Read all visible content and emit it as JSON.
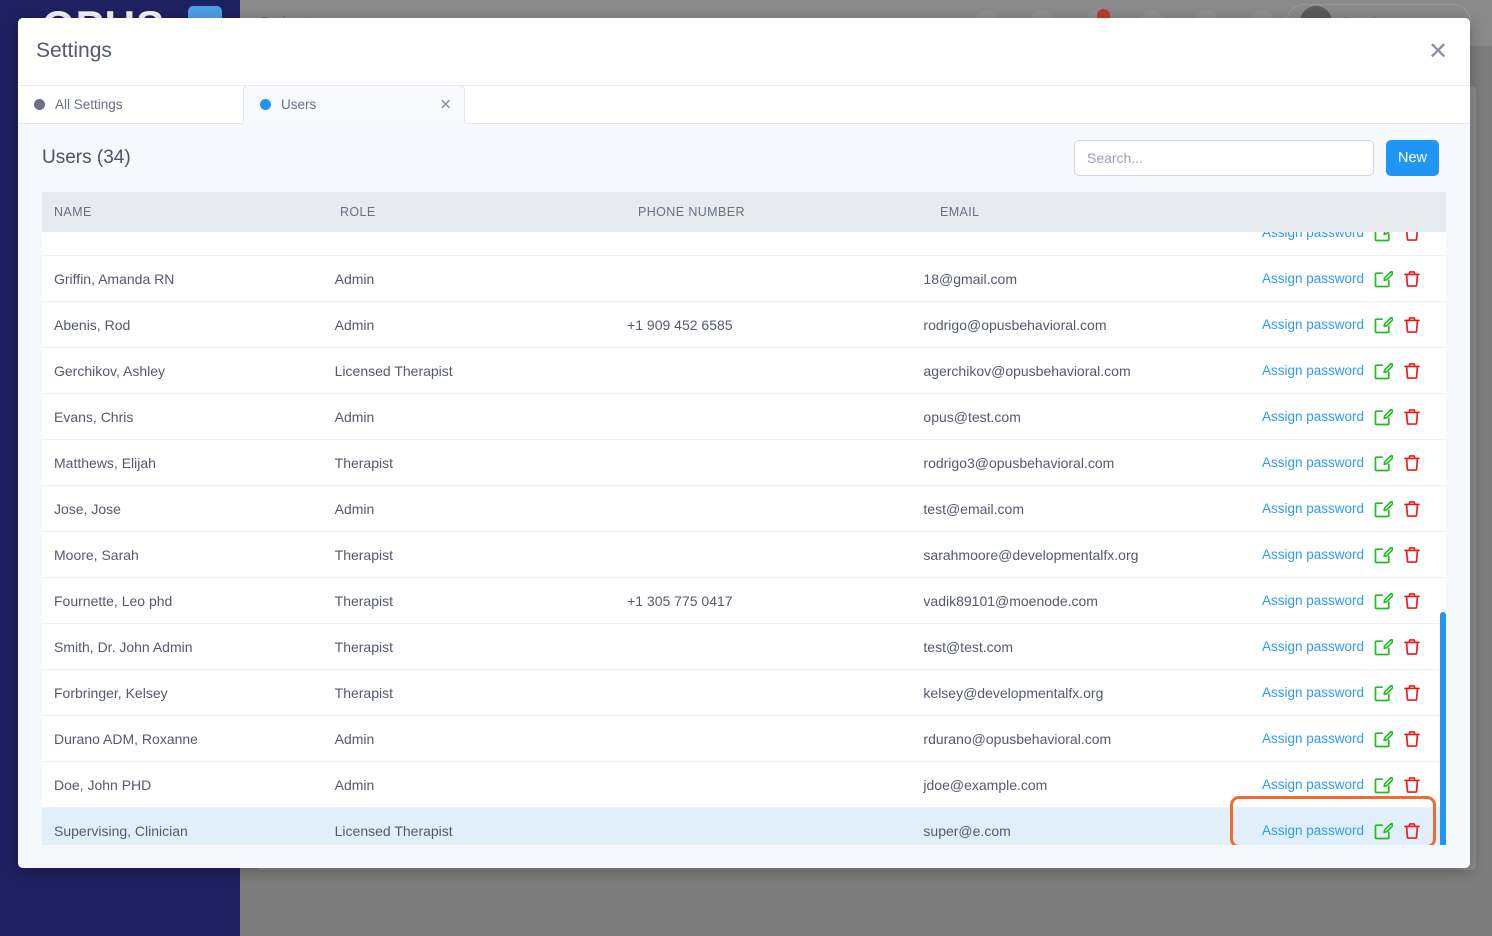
{
  "background": {
    "logo_text": "OPUS",
    "topbar_title": "Patients",
    "username": "Jonathan"
  },
  "modal": {
    "title": "Settings",
    "close_icon": "close-icon"
  },
  "tabs": [
    {
      "label": "All Settings",
      "dot": "grey-dot-icon",
      "active": false,
      "closable": false
    },
    {
      "label": "Users",
      "dot": "blue-dot-icon",
      "active": true,
      "closable": true,
      "close_icon": "close-icon"
    }
  ],
  "toolbar": {
    "heading": "Users (34)",
    "search_placeholder": "Search...",
    "search_value": "",
    "new_label": "New"
  },
  "table": {
    "columns": [
      "NAME",
      "ROLE",
      "PHONE NUMBER",
      "EMAIL",
      ""
    ],
    "action_label": "Assign password",
    "edit_icon": "edit-pencil-icon",
    "delete_icon": "trash-icon",
    "rows": [
      {
        "name": "",
        "role": "",
        "phone": "",
        "email": "",
        "selected": false
      },
      {
        "name": "Griffin, Amanda RN",
        "role": "Admin",
        "phone": "",
        "email": "18@gmail.com",
        "selected": false
      },
      {
        "name": "Abenis, Rod",
        "role": "Admin",
        "phone": "+1 909 452 6585",
        "email": "rodrigo@opusbehavioral.com",
        "selected": false
      },
      {
        "name": "Gerchikov, Ashley",
        "role": "Licensed Therapist",
        "phone": "",
        "email": "agerchikov@opusbehavioral.com",
        "selected": false
      },
      {
        "name": "Evans, Chris",
        "role": "Admin",
        "phone": "",
        "email": "opus@test.com",
        "selected": false
      },
      {
        "name": "Matthews, Elijah",
        "role": "Therapist",
        "phone": "",
        "email": "rodrigo3@opusbehavioral.com",
        "selected": false
      },
      {
        "name": "Jose, Jose",
        "role": "Admin",
        "phone": "",
        "email": "test@email.com",
        "selected": false
      },
      {
        "name": "Moore, Sarah",
        "role": "Therapist",
        "phone": "",
        "email": "sarahmoore@developmentalfx.org",
        "selected": false
      },
      {
        "name": "Fournette, Leo phd",
        "role": "Therapist",
        "phone": "+1 305 775 0417",
        "email": "vadik89101@moenode.com",
        "selected": false
      },
      {
        "name": "Smith, Dr. John Admin",
        "role": "Therapist",
        "phone": "",
        "email": "test@test.com",
        "selected": false
      },
      {
        "name": "Forbringer, Kelsey",
        "role": "Therapist",
        "phone": "",
        "email": "kelsey@developmentalfx.org",
        "selected": false
      },
      {
        "name": "Durano ADM, Roxanne",
        "role": "Admin",
        "phone": "",
        "email": "rdurano@opusbehavioral.com",
        "selected": false
      },
      {
        "name": "Doe, John PHD",
        "role": "Admin",
        "phone": "",
        "email": "jdoe@example.com",
        "selected": false
      },
      {
        "name": "Supervising, Clinician",
        "role": "Licensed Therapist",
        "phone": "",
        "email": "super@e.com",
        "selected": true
      }
    ]
  },
  "colors": {
    "accent_blue": "#1f96f3",
    "link_blue": "#2f9cf2",
    "edit_green": "#22bb22",
    "delete_red": "#f01a1a",
    "highlight_orange": "#ef6c2f",
    "selected_row": "#e1effb",
    "sidebar_navy": "#1e2161"
  },
  "scrollbar": {
    "orientation": "vertical",
    "position": "right"
  }
}
